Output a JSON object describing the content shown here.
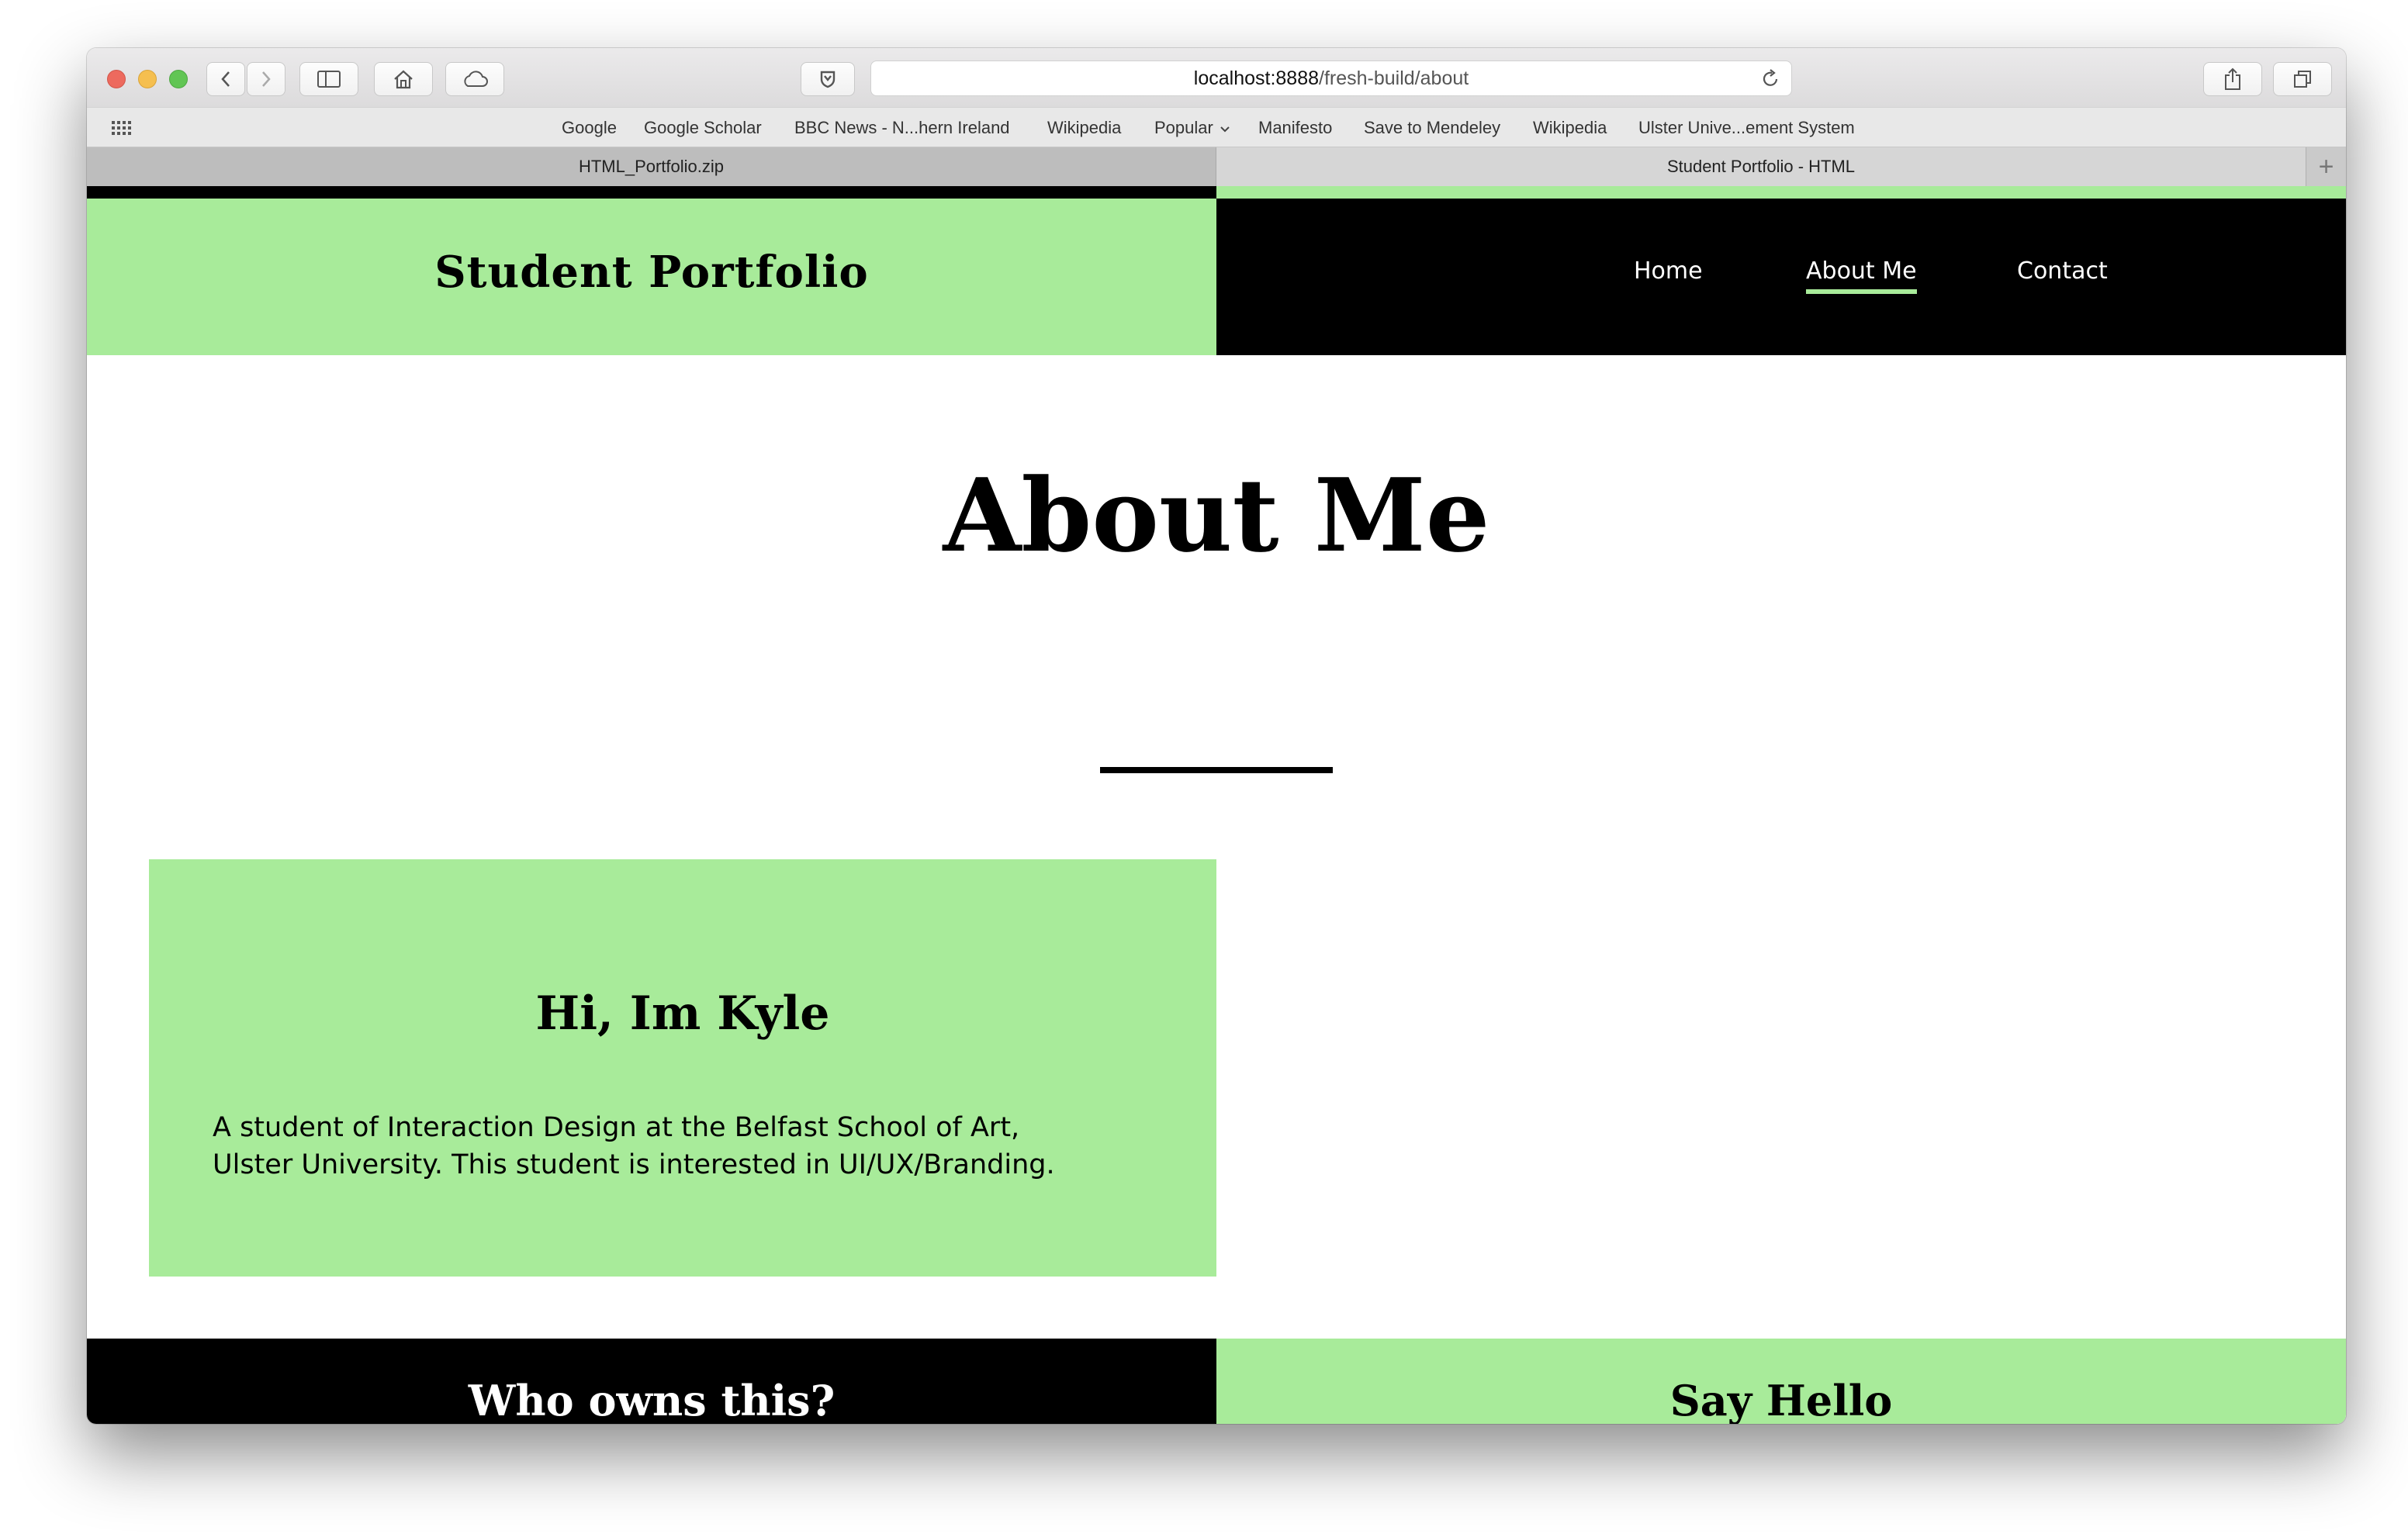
{
  "browser": {
    "url_host": "localhost:8888",
    "url_path": "/fresh-build/about",
    "favorites": [
      "Google",
      "Google Scholar",
      "BBC News - N...hern Ireland",
      "Wikipedia",
      "Popular",
      "Manifesto",
      "Save to Mendeley",
      "Wikipedia",
      "Ulster Unive...ement System"
    ],
    "tabs": [
      {
        "label": "HTML_Portfolio.zip",
        "active": false
      },
      {
        "label": "Student Portfolio - HTML",
        "active": true
      }
    ],
    "new_tab": "+"
  },
  "site": {
    "title": "Student Portfolio",
    "nav": [
      {
        "label": "Home",
        "active": false
      },
      {
        "label": "About Me",
        "active": true
      },
      {
        "label": "Contact",
        "active": false
      }
    ]
  },
  "main": {
    "heading": "About Me",
    "intro_title": "Hi, Im Kyle",
    "intro_text": "A student of Interaction Design at the Belfast School of Art, Ulster University. This student is interested in UI/UX/Branding."
  },
  "footer": {
    "left_title": "Who owns this?",
    "right_title": "Say Hello"
  },
  "colors": {
    "accent_green": "#a8eb9a",
    "black": "#000000",
    "white": "#ffffff"
  }
}
